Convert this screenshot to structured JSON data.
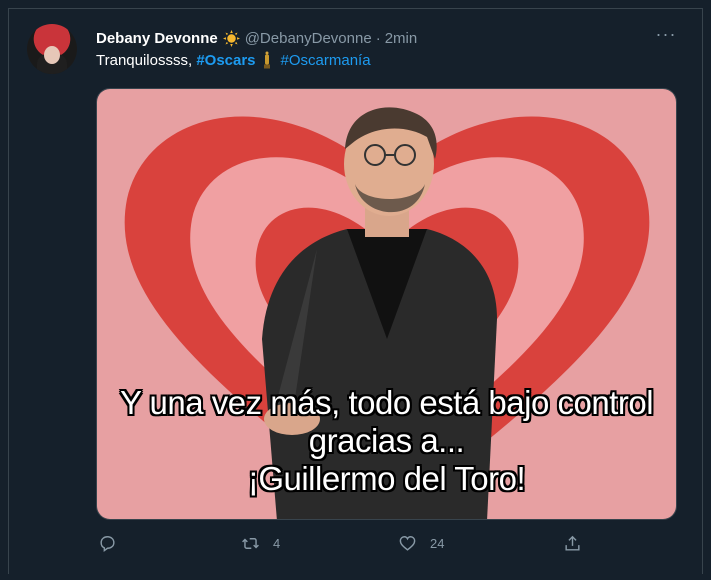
{
  "tweet": {
    "display_name": "Debany Devonne",
    "badge_icon": "sun-emoji",
    "handle": "@DebanyDevonne",
    "separator": "·",
    "time": "2min",
    "text_plain": "Tranquilossss, ",
    "hashtag_1": "#Oscars",
    "oscar_icon": "oscar-statuette-emoji",
    "hashtag_2": "#Oscarmanía"
  },
  "media": {
    "caption_lines": [
      "Y una vez más, todo está bajo control",
      "gracias a...",
      "¡Guillermo del Toro!"
    ],
    "colors": {
      "heart_red": "#d9423d",
      "heart_pink": "#f0a0a2"
    }
  },
  "actions": {
    "reply_icon": "reply-bubble-icon",
    "retweet_icon": "retweet-icon",
    "retweet_count": "4",
    "like_icon": "heart-icon",
    "like_count": "24",
    "share_icon": "share-icon"
  },
  "more_icon": "more-dots-icon",
  "colors": {
    "background": "#15202b",
    "accent": "#1d9bf0",
    "muted": "#8899a6"
  }
}
